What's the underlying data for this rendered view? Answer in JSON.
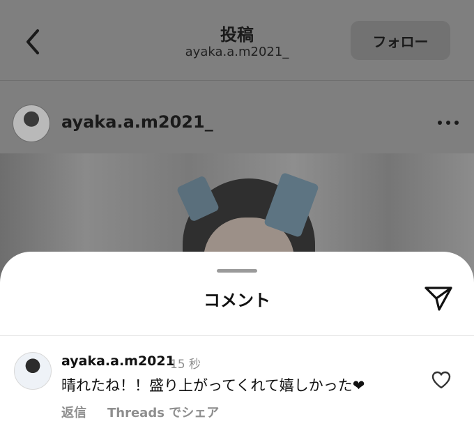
{
  "header": {
    "title": "投稿",
    "subtitle": "ayaka.a.m2021_",
    "follow_label": "フォロー"
  },
  "post": {
    "author": "ayaka.a.m2021_"
  },
  "comments_sheet": {
    "title": "コメント",
    "comment": {
      "username": "ayaka.a.m2021",
      "time": "15 秒",
      "text": "晴れたね！！盛り上がってくれて嬉しかった❤",
      "reply_label": "返信",
      "share_label": "Threads でシェア"
    }
  },
  "icons": [
    "back-chevron-icon",
    "more-dots-icon",
    "send-icon",
    "heart-icon"
  ],
  "colors": {
    "overlay": "#7f7f7f",
    "sheet": "#ffffff",
    "muted": "#8e8e8e"
  }
}
